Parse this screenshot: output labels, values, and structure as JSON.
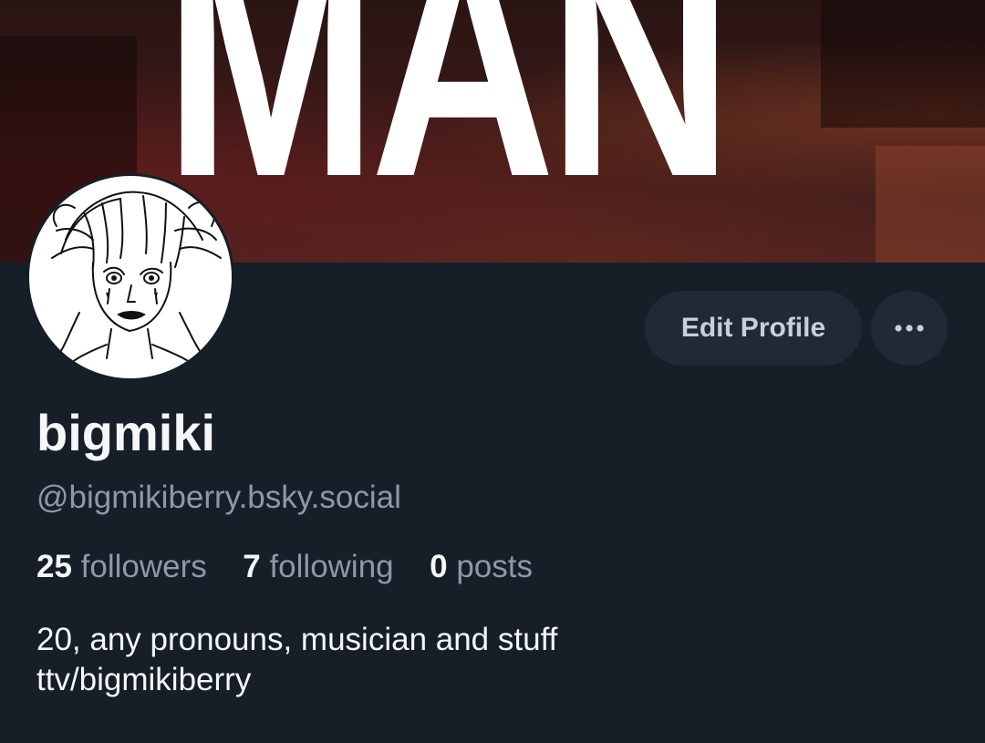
{
  "banner": {
    "text": "MAN"
  },
  "profile": {
    "display_name": "bigmiki",
    "handle": "@bigmikiberry.bsky.social",
    "bio_lines": [
      "20, any pronouns, musician and stuff",
      "ttv/bigmikiberry"
    ]
  },
  "stats": {
    "followers_count": "25",
    "followers_label": "followers",
    "following_count": "7",
    "following_label": "following",
    "posts_count": "0",
    "posts_label": "posts"
  },
  "actions": {
    "edit_profile_label": "Edit Profile",
    "more_icon": "ellipsis-icon"
  },
  "colors": {
    "background": "#161e27",
    "button_bg": "#1f2a36",
    "secondary_text": "#8d99a6",
    "primary_text": "#f4f6f8"
  }
}
